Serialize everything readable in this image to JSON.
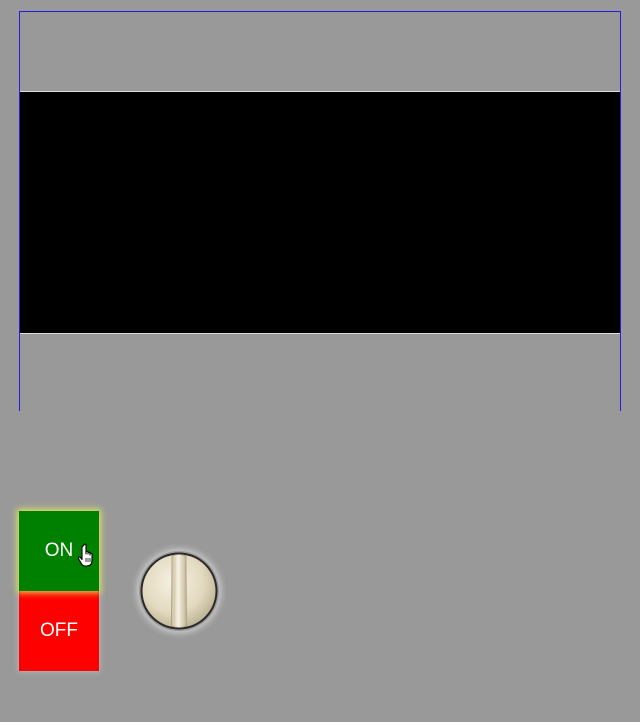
{
  "display": {
    "border_color": "#2020e0",
    "screen_color": "#000000"
  },
  "power_switch": {
    "on_label": "ON",
    "off_label": "OFF",
    "on_color": "#008000",
    "off_color": "#ff0000",
    "state": "on"
  },
  "rotary_knob": {
    "color": "#e8e0c8"
  },
  "cursor": {
    "icon": "hand-pointer-icon"
  },
  "background_color": "#999999"
}
